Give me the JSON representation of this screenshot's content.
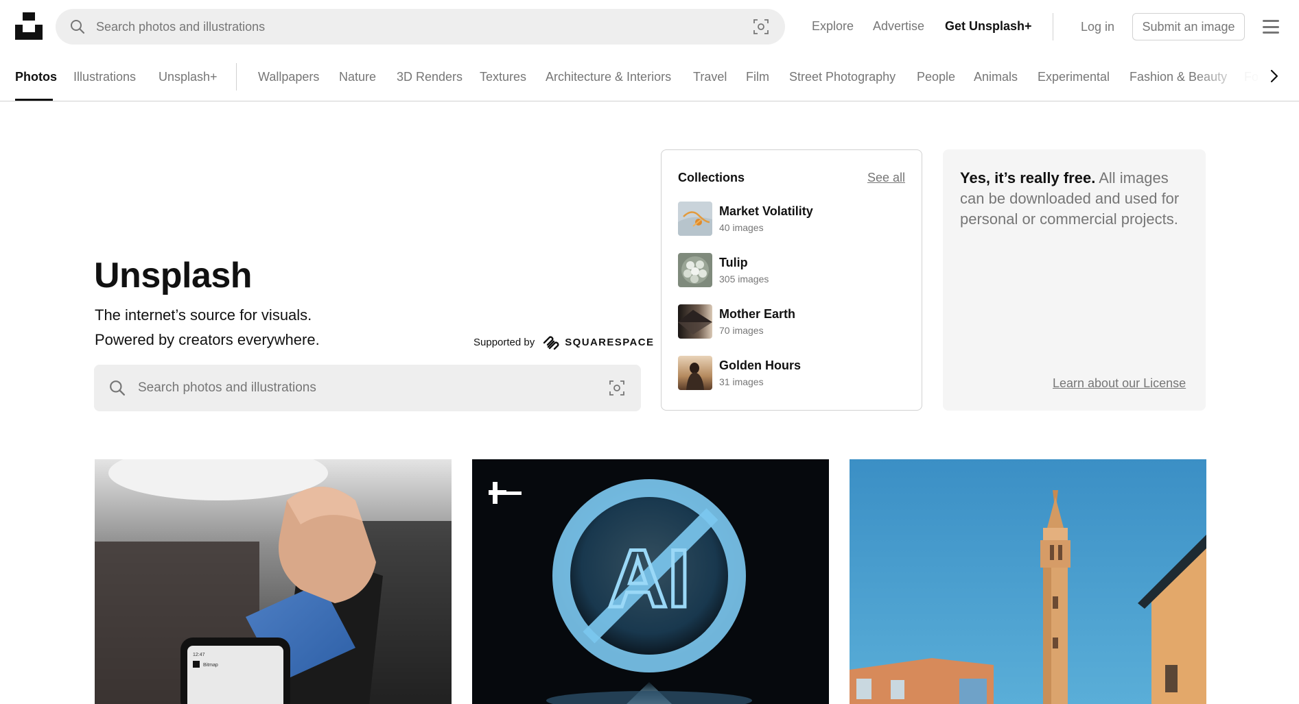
{
  "header": {
    "search_placeholder": "Search photos and illustrations",
    "nav": {
      "explore": "Explore",
      "advertise": "Advertise",
      "get_plus": "Get Unsplash+",
      "login": "Log in",
      "submit": "Submit an image"
    }
  },
  "categories": {
    "primary": [
      "Photos",
      "Illustrations",
      "Unsplash+"
    ],
    "topics": [
      "Wallpapers",
      "Nature",
      "3D Renders",
      "Textures",
      "Architecture & Interiors",
      "Travel",
      "Film",
      "Street Photography",
      "People",
      "Animals",
      "Experimental",
      "Fashion & Beauty",
      "Fo"
    ],
    "active": "Photos"
  },
  "hero": {
    "title": "Unsplash",
    "line1": "The internet’s source for visuals.",
    "line2": "Powered by creators everywhere.",
    "supported_by": "Supported by",
    "sponsor": "SQUARESPACE",
    "search_placeholder": "Search photos and illustrations"
  },
  "collections": {
    "title": "Collections",
    "see_all": "See all",
    "items": [
      {
        "name": "Market Volatility",
        "count": "40 images"
      },
      {
        "name": "Tulip",
        "count": "305 images"
      },
      {
        "name": "Mother Earth",
        "count": "70 images"
      },
      {
        "name": "Golden Hours",
        "count": "31 images"
      }
    ]
  },
  "free_card": {
    "bold": "Yes, it’s really free.",
    "rest": " All images can be downloaded and used for personal or commercial projects.",
    "link": "Learn about our License"
  },
  "photos": {
    "p1": {
      "phone_status": "12:47",
      "phone_text": "Bitmap"
    },
    "p2": {
      "glyph": "AI"
    }
  },
  "colors": {
    "text_primary": "#111111",
    "text_secondary": "#767676",
    "border": "#d1d1d1",
    "search_bg": "#eeeeee",
    "card_bg": "#f5f5f5"
  },
  "icons": [
    "unsplash-logo-icon",
    "search-icon",
    "visual-search-icon",
    "menu-icon",
    "chevron-right-icon",
    "squarespace-logo-icon",
    "unsplash-plus-icon"
  ]
}
